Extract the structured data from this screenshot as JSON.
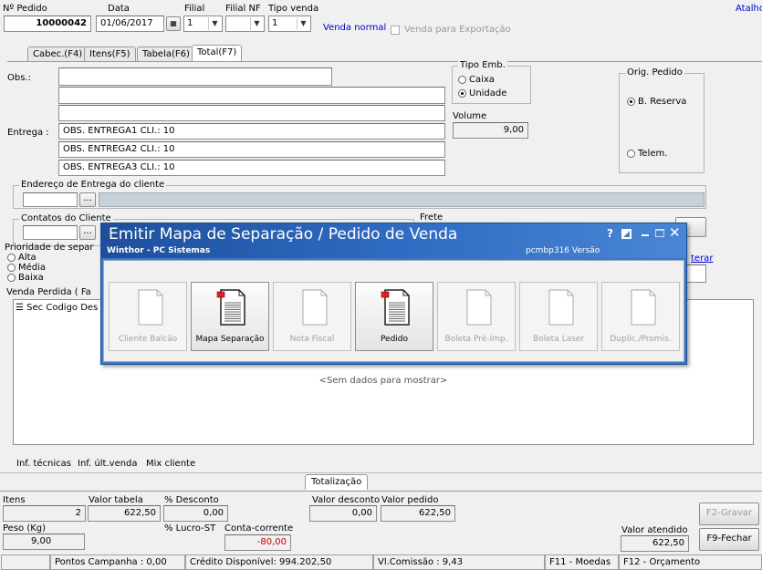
{
  "header": {
    "pedido_label": "Nº Pedido",
    "pedido_value": "10000042",
    "data_label": "Data",
    "data_value": "01/06/2017",
    "filial_label": "Filial",
    "filial_value": "1",
    "filial_nf_label": "Filial NF",
    "filial_nf_value": "",
    "tipo_venda_label": "Tipo venda",
    "tipo_venda_value": "1",
    "tipo_venda_desc": "Venda normal",
    "exportacao_label": "Venda para Exportação",
    "atalho_link": "Atalho"
  },
  "tabs": [
    "Cabec.(F4)",
    "Itens(F5)",
    "Tabela(F6)",
    "Total(F7)"
  ],
  "form": {
    "obs_label": "Obs.:",
    "entrega_label": "Entrega :",
    "entrega_lines": [
      "OBS. ENTREGA1 CLI.: 10",
      "OBS. ENTREGA2 CLI.: 10",
      "OBS. ENTREGA3 CLI.: 10"
    ],
    "tipo_emb_label": "Tipo Emb.",
    "caixa_label": "Caixa",
    "unidade_label": "Unidade",
    "volume_label": "Volume",
    "volume_value": "9,00",
    "orig_pedido_label": "Orig. Pedido",
    "b_reserva_label": "B. Reserva",
    "telem_label": "Telem.",
    "endereco_label": "Endereço de Entrega do cliente",
    "contatos_label": "Contatos do Cliente",
    "frete_label": "Frete",
    "prioridade_label": "Prioridade de separ",
    "prio_alta": "Alta",
    "prio_media": "Média",
    "prio_baixa": "Baixa",
    "alterar_link": "terar",
    "venda_perdida_label": "Venda Perdida ( Fa",
    "grid_cols": [
      "Sec",
      "Codigo",
      "Des"
    ],
    "empty_text": "<Sem dados para mostrar>",
    "ellipsis": "..."
  },
  "bottom_tabs": [
    "Inf. técnicas",
    "Inf. últ.venda",
    "Mix cliente"
  ],
  "totals": {
    "totalizacao_tab": "Totalização",
    "itens_label": "Itens",
    "itens_value": "2",
    "valor_tabela_label": "Valor tabela",
    "valor_tabela_value": "622,50",
    "desconto_label": "% Desconto",
    "desconto_value": "0,00",
    "valor_desconto_label": "Valor desconto",
    "valor_desconto_value": "0,00",
    "valor_pedido_label": "Valor pedido",
    "valor_pedido_value": "622,50",
    "peso_label": "Peso (Kg)",
    "peso_value": "9,00",
    "lucro_label": "% Lucro-ST",
    "conta_label": "Conta-corrente",
    "conta_value": "-80,00",
    "valor_atendido_label": "Valor atendido",
    "valor_atendido_value": "622,50",
    "gravar_button": "F2-Gravar",
    "fechar_button": "F9-Fechar"
  },
  "status": {
    "pontos": "Pontos Campanha : 0,00",
    "credito": "Crédito Disponível: 994.202,50",
    "comissao": "Vl.Comissão : 9,43",
    "moedas": "F11 - Moedas",
    "orcamento": "F12 - Orçamento"
  },
  "modal": {
    "title": "Emitir Mapa de Separação / Pedido de Venda",
    "subtitle": "Winthor - PC Sistemas",
    "version": "pcmbp316  Versão",
    "help": "?",
    "buttons": [
      {
        "label": "Cliente Balcão",
        "enabled": false
      },
      {
        "label": "Mapa Separação",
        "enabled": true
      },
      {
        "label": "Nota Fiscal",
        "enabled": false
      },
      {
        "label": "Pedido",
        "enabled": true
      },
      {
        "label": "Boleta Pré-Imp.",
        "enabled": false
      },
      {
        "label": "Boleta Laser",
        "enabled": false
      },
      {
        "label": "Duplic./Promis.",
        "enabled": false
      }
    ]
  },
  "colors": {
    "title_blue": "#1e4f9c",
    "link_blue": "#0000cc",
    "negative_red": "#cc0000"
  }
}
